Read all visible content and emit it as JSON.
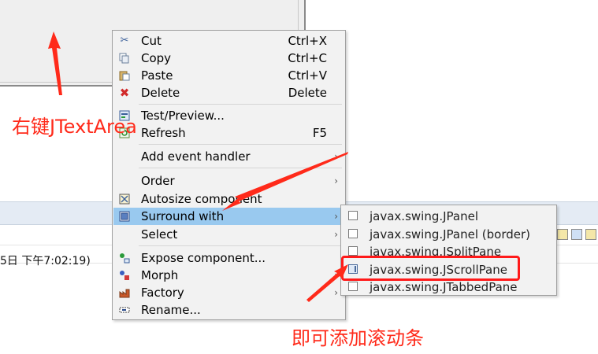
{
  "console": {
    "timestamp_text": "5日 下午7:02:19)"
  },
  "context_menu": {
    "items": [
      {
        "label": "Cut",
        "accel": "Ctrl+X",
        "icon": "scissors-icon"
      },
      {
        "label": "Copy",
        "accel": "Ctrl+C",
        "icon": "copy-icon"
      },
      {
        "label": "Paste",
        "accel": "Ctrl+V",
        "icon": "paste-icon"
      },
      {
        "label": "Delete",
        "accel": "Delete",
        "icon": "delete-x-icon"
      },
      {
        "label": "Test/Preview...",
        "icon": "preview-icon"
      },
      {
        "label": "Refresh",
        "accel": "F5",
        "icon": "refresh-icon"
      },
      {
        "label": "Add event handler",
        "has_submenu": true
      },
      {
        "label": "Order",
        "has_submenu": true
      },
      {
        "label": "Autosize component",
        "icon": "autosize-icon"
      },
      {
        "label": "Surround with",
        "has_submenu": true,
        "selected": true,
        "icon": "surround-icon"
      },
      {
        "label": "Select",
        "has_submenu": true
      },
      {
        "label": "Expose component...",
        "icon": "expose-icon"
      },
      {
        "label": "Morph",
        "has_submenu": true,
        "icon": "morph-icon"
      },
      {
        "label": "Factory",
        "has_submenu": true,
        "icon": "factory-icon"
      },
      {
        "label": "Rename...",
        "icon": "rename-icon"
      }
    ],
    "arrow_glyph": "›",
    "selected_color": "#99c9ef"
  },
  "surround_submenu": {
    "items": [
      {
        "label": "javax.swing.JPanel"
      },
      {
        "label": "javax.swing.JPanel (border)"
      },
      {
        "label": "javax.swing.JSplitPane"
      },
      {
        "label": "javax.swing.JScrollPane",
        "highlighted": true
      },
      {
        "label": "javax.swing.JTabbedPane"
      }
    ]
  },
  "annotations": {
    "right_click_label": "右键JTextArea",
    "result_label": "即可添加滚动条",
    "color": "#ff2a1a"
  }
}
